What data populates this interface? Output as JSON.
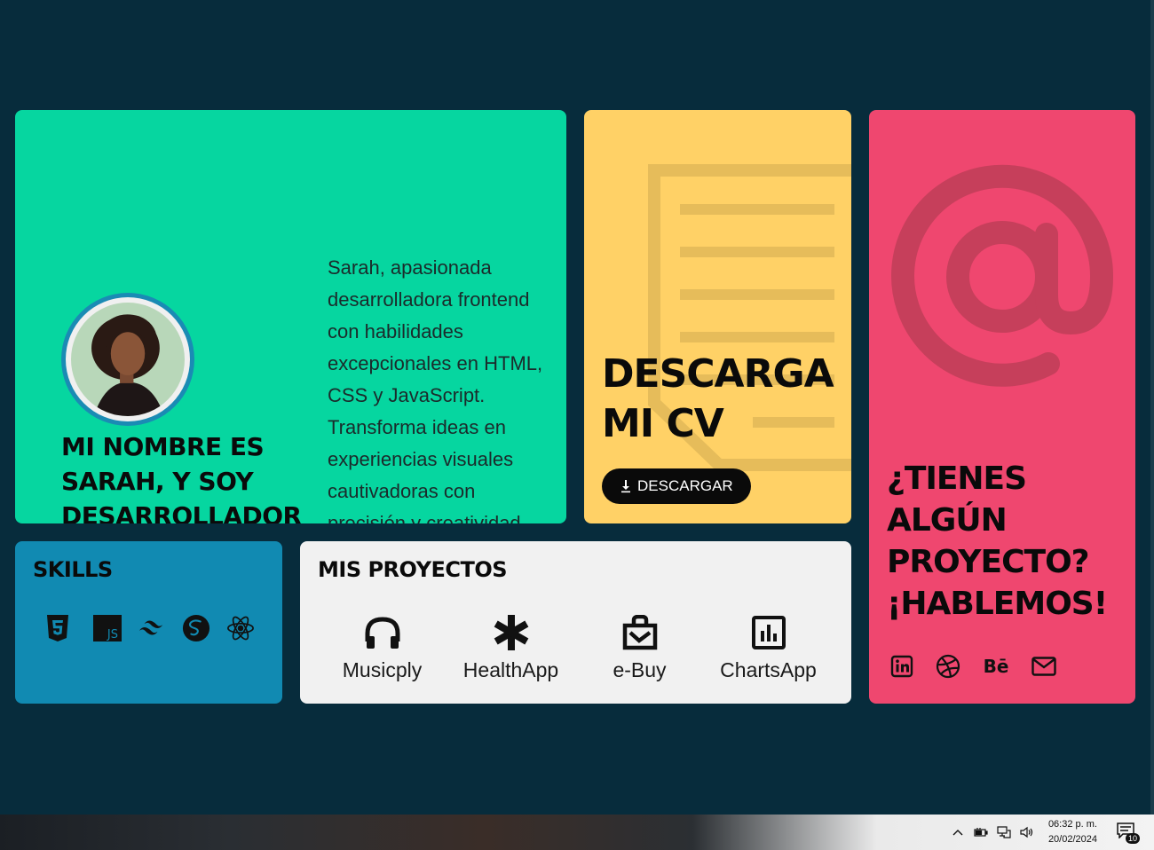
{
  "colors": {
    "background": "#072c3c",
    "hero": "#06d6a0",
    "cv": "#ffd166",
    "contact": "#ef476f",
    "skills": "#118ab2",
    "projects": "#f1f1f1"
  },
  "hero": {
    "title": "MI NOMBRE ES SARAH, Y SOY DESARROLLADOR FRONTEND",
    "description": "Sarah, apasionada desarrolladora frontend con habilidades excepcionales en HTML, CSS y JavaScript. Transforma ideas en experiencias visuales cautivadoras con precisión y creatividad.",
    "avatar_icon": "avatar-photo"
  },
  "cv": {
    "title": "DESCARGA MI CV",
    "button_label": "DESCARGAR",
    "button_icon": "download-icon",
    "background_icon": "document-icon"
  },
  "contact": {
    "title": "¿TIENES ALGÚN PROYECTO? ¡HABLEMOS!",
    "background_icon": "at-sign-icon",
    "socials": [
      {
        "icon": "linkedin-icon"
      },
      {
        "icon": "dribbble-icon"
      },
      {
        "icon": "behance-icon",
        "label": "Bē"
      },
      {
        "icon": "mail-icon"
      }
    ]
  },
  "skills": {
    "title": "SKILLS",
    "items": [
      {
        "icon": "html5-icon"
      },
      {
        "icon": "javascript-icon",
        "label": "JS"
      },
      {
        "icon": "tailwind-icon"
      },
      {
        "icon": "sass-icon"
      },
      {
        "icon": "react-icon"
      }
    ]
  },
  "projects": {
    "title": "MIS PROYECTOS",
    "items": [
      {
        "label": "Musicply",
        "icon": "headphones-icon"
      },
      {
        "label": "HealthApp",
        "icon": "asterisk-icon"
      },
      {
        "label": "e-Buy",
        "icon": "shopping-bag-icon"
      },
      {
        "label": "ChartsApp",
        "icon": "bar-chart-icon"
      }
    ]
  },
  "taskbar": {
    "time": "06:32 p. m.",
    "date": "20/02/2024",
    "notifications": "10",
    "tray_icons": [
      "chevron-up-icon",
      "battery-icon",
      "network-icon",
      "volume-icon"
    ]
  }
}
